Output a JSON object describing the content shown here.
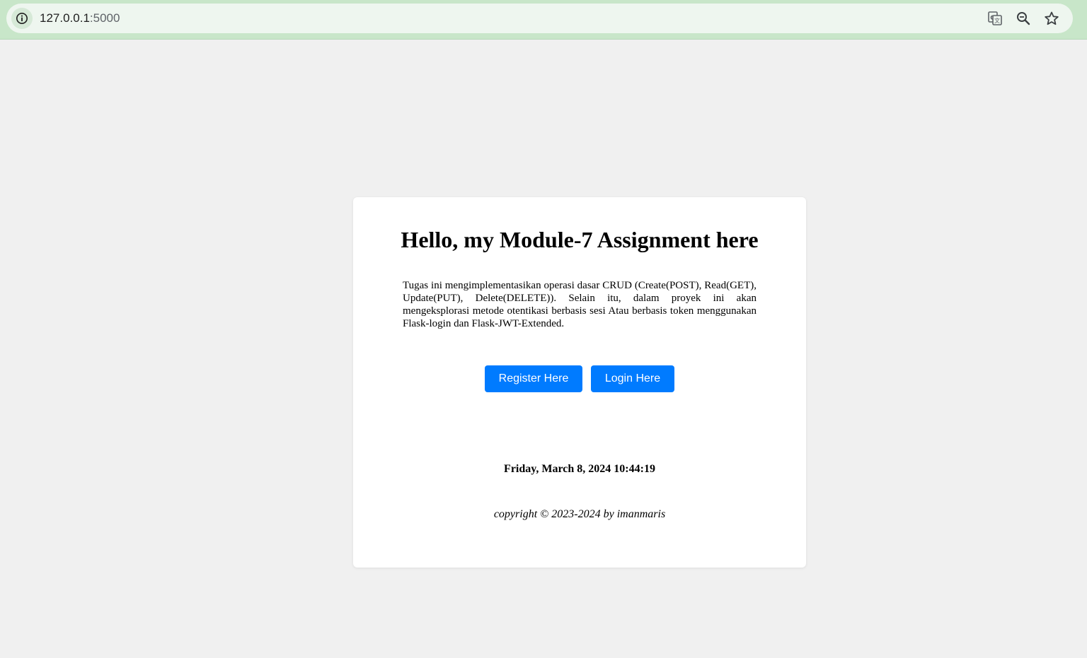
{
  "browser": {
    "url_host": "127.0.0.1",
    "url_port": ":5000",
    "icons": [
      "info-icon",
      "translate-icon",
      "zoom-icon",
      "bookmark-star-icon"
    ]
  },
  "page": {
    "title": "Hello, my Module-7 Assignment here",
    "description": "Tugas ini mengimplementasikan operasi dasar CRUD (Create(POST), Read(GET), Update(PUT), Delete(DELETE)). Selain itu, dalam proyek ini akan mengeksplorasi metode otentikasi berbasis sesi Atau berbasis token menggunakan Flask-login dan Flask-JWT-Extended.",
    "register_label": "Register Here",
    "login_label": "Login Here",
    "datetime": "Friday, March 8, 2024 10:44:19",
    "copyright": "copyright © 2023-2024 by imanmaris"
  },
  "colors": {
    "page_background": "#f0f0f0",
    "card_background": "#ffffff",
    "button_primary": "#007bff",
    "browser_bar": "#c8e6c9"
  }
}
